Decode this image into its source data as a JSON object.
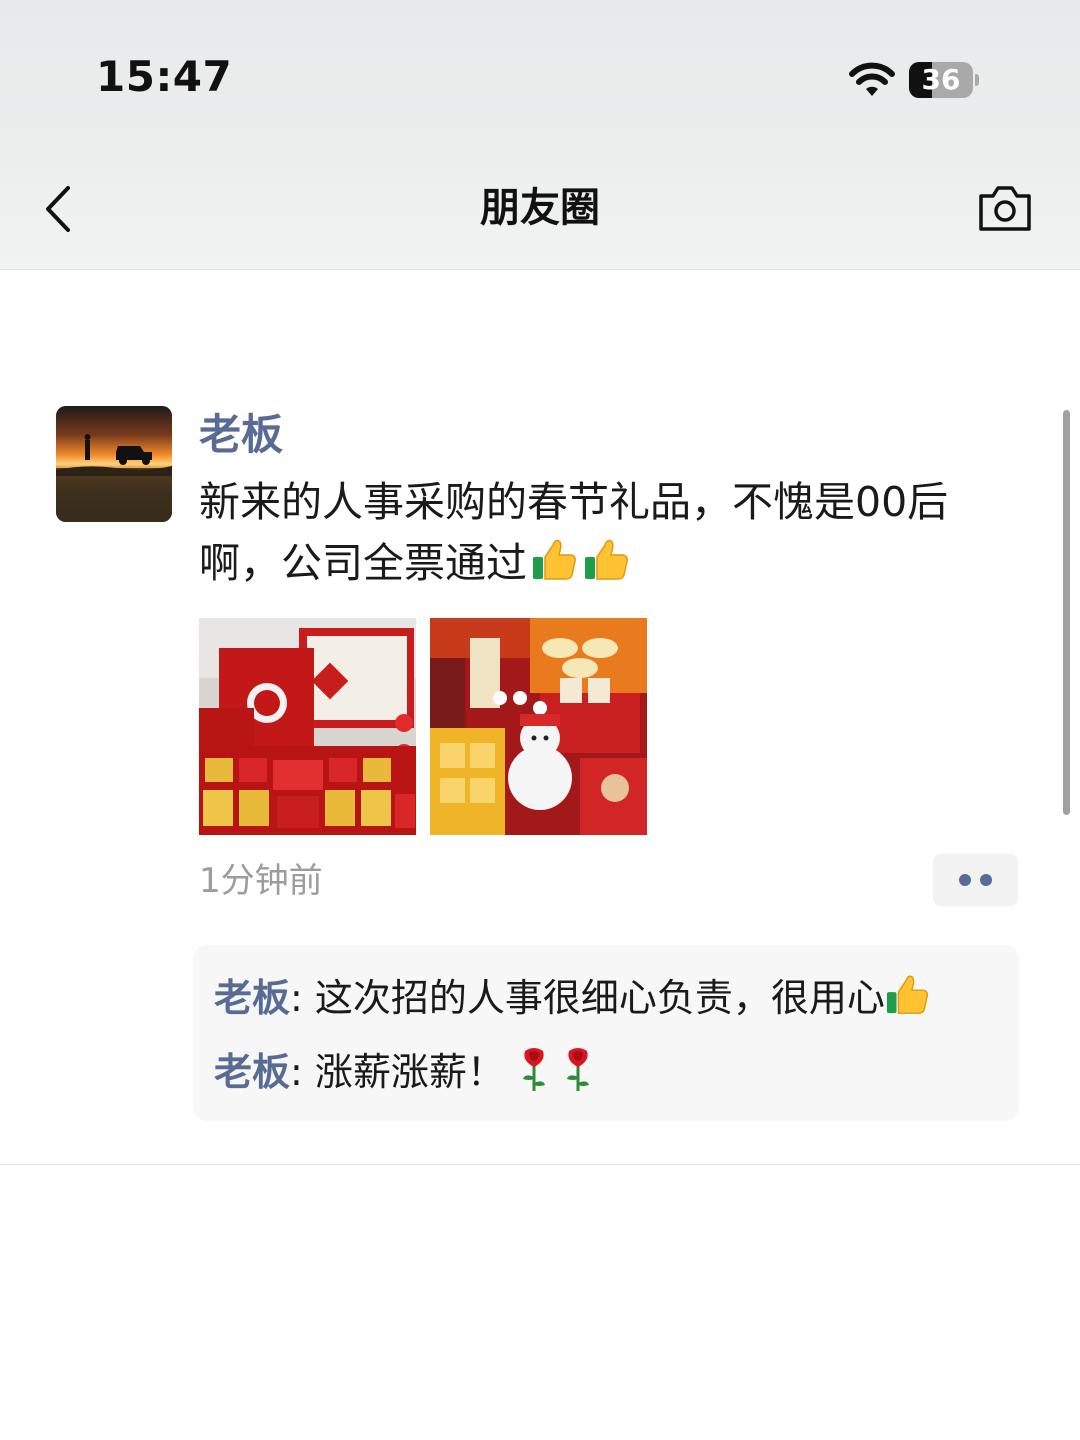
{
  "status_bar": {
    "time": "15:47",
    "battery_level": "36"
  },
  "header": {
    "title": "朋友圈",
    "back_icon": "chevron-left-icon",
    "camera_icon": "camera-icon"
  },
  "post": {
    "author": "老板",
    "text": "新来的人事采购的春节礼品，不愧是00后啊，公司全票通过",
    "text_emojis": [
      "thumbs-up-icon",
      "thumbs-up-icon"
    ],
    "photos": [
      "photo-red-gift-boxes",
      "photo-snowman-gift-set"
    ],
    "time": "1分钟前",
    "more_icon": "more-dots-icon"
  },
  "comments": [
    {
      "author": "老板",
      "separator": ": ",
      "text": "这次招的人事很细心负责，很用心",
      "emoji": "thumbs-up-icon"
    },
    {
      "author": "老板",
      "separator": ": ",
      "text": "涨薪涨薪！",
      "emoji": "rose-icon"
    }
  ],
  "colors": {
    "link_blue": "#576b95",
    "time_gray": "#9c9c9c",
    "comment_bg": "#f7f7f7"
  }
}
